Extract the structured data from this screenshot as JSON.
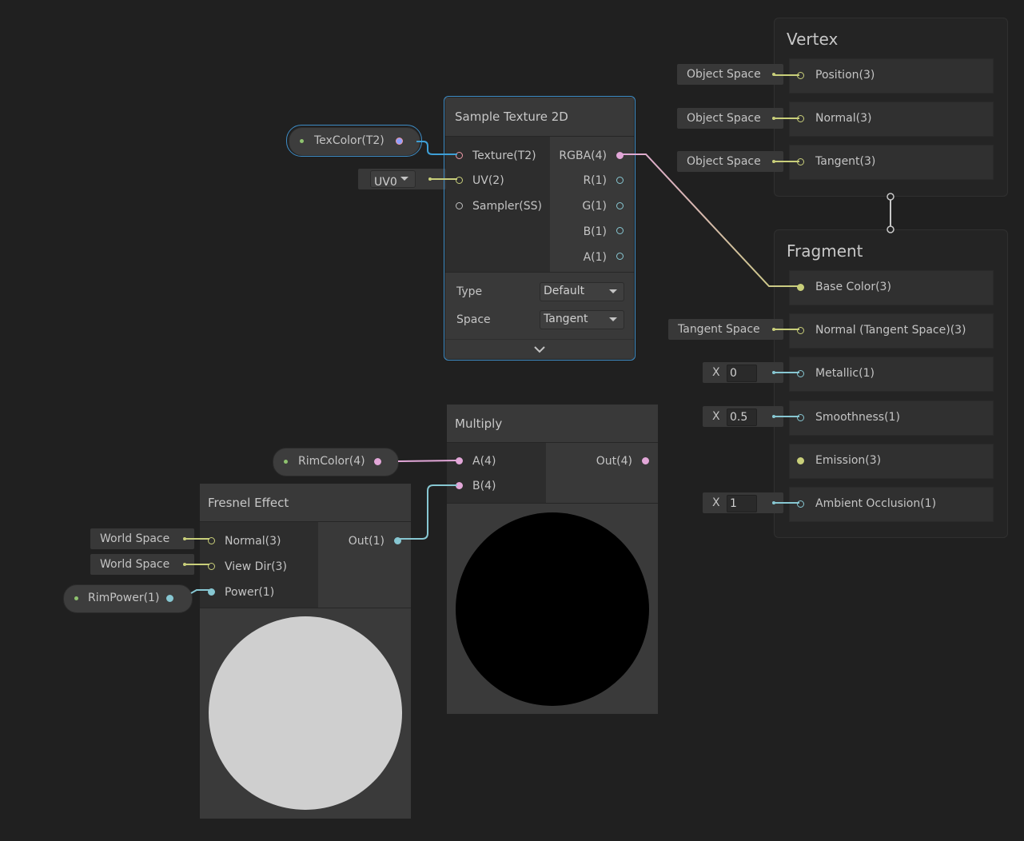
{
  "colors": {
    "background": "#202020",
    "selection": "#3e8cc5",
    "vector3": "#c9cf7a",
    "vector4": "#e2a7d8",
    "vector1": "#87c7d2",
    "texture": "#f09aa8",
    "sampler": "#c0c0c0"
  },
  "vertex": {
    "title": "Vertex",
    "blocks": [
      {
        "label": "Position(3)",
        "space": "Object Space"
      },
      {
        "label": "Normal(3)",
        "space": "Object Space"
      },
      {
        "label": "Tangent(3)",
        "space": "Object Space"
      }
    ]
  },
  "fragment": {
    "title": "Fragment",
    "base_color": "Base Color(3)",
    "normal": {
      "label": "Normal (Tangent Space)(3)",
      "space": "Tangent Space"
    },
    "metallic": {
      "label": "Metallic(1)",
      "axis": "X",
      "value": "0"
    },
    "smoothness": {
      "label": "Smoothness(1)",
      "axis": "X",
      "value": "0.5"
    },
    "emission": "Emission(3)",
    "ao": {
      "label": "Ambient Occlusion(1)",
      "axis": "X",
      "value": "1"
    }
  },
  "sample_texture": {
    "title": "Sample Texture 2D",
    "inputs": [
      "Texture(T2)",
      "UV(2)",
      "Sampler(SS)"
    ],
    "outputs": [
      "RGBA(4)",
      "R(1)",
      "G(1)",
      "B(1)",
      "A(1)"
    ],
    "type_label": "Type",
    "type_value": "Default",
    "space_label": "Space",
    "space_value": "Tangent",
    "uv_dropdown": "UV0"
  },
  "properties": {
    "tex_color": "TexColor(T2)",
    "rim_color": "RimColor(4)",
    "rim_power": "RimPower(1)"
  },
  "multiply": {
    "title": "Multiply",
    "inputs": [
      "A(4)",
      "B(4)"
    ],
    "output": "Out(4)",
    "preview": "black"
  },
  "fresnel": {
    "title": "Fresnel Effect",
    "inputs": [
      "Normal(3)",
      "View Dir(3)",
      "Power(1)"
    ],
    "output": "Out(1)",
    "normal_space": "World Space",
    "viewdir_space": "World Space",
    "preview": "white"
  }
}
